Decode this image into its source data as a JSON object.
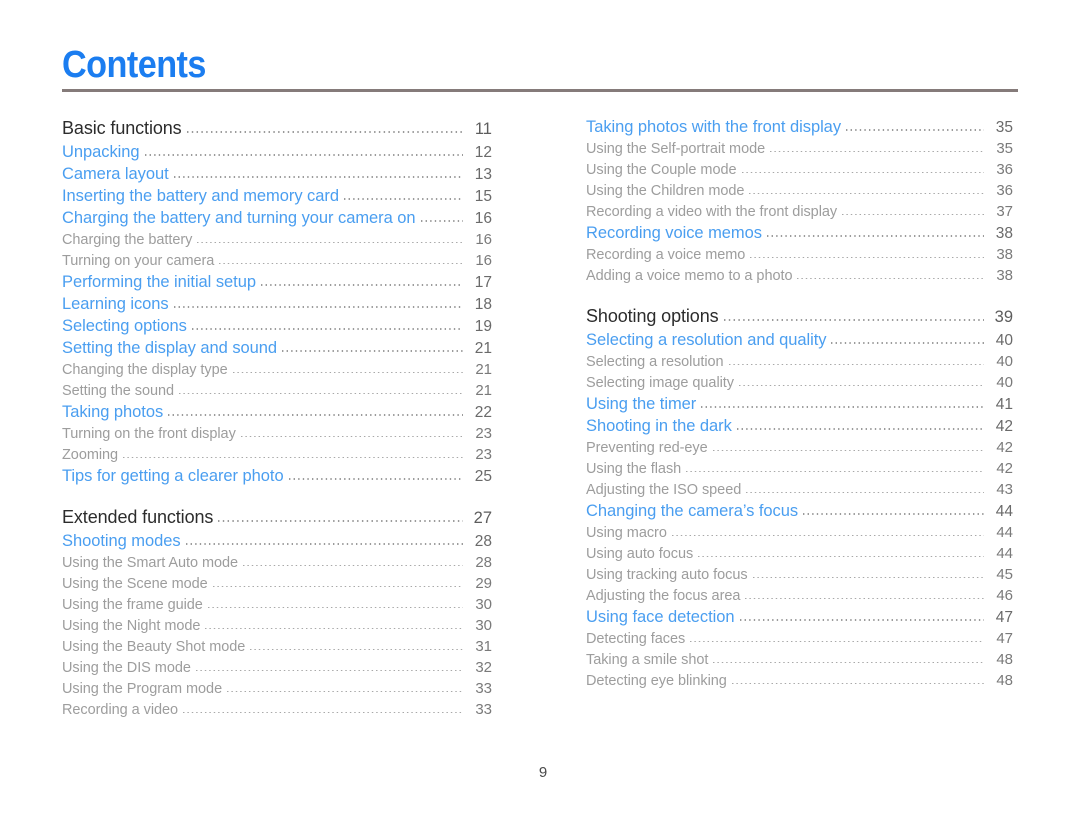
{
  "document": {
    "title": "Contents",
    "folio": "9",
    "accent_title_color": "#1b7df0",
    "link_color": "#4a9ef0",
    "subitem_color": "#9d9d9d",
    "section_color": "#2c2c2c",
    "rule_color": "#857b7a"
  },
  "columns": {
    "left": [
      {
        "level": "section",
        "label": "Basic functions",
        "page": "11"
      },
      {
        "level": "1",
        "label": "Unpacking",
        "page": "12"
      },
      {
        "level": "1",
        "label": "Camera layout",
        "page": "13"
      },
      {
        "level": "1",
        "label": "Inserting the battery and memory card",
        "page": "15"
      },
      {
        "level": "1",
        "label": "Charging the battery and turning your camera on",
        "page": "16"
      },
      {
        "level": "2",
        "label": "Charging the battery",
        "page": "16"
      },
      {
        "level": "2",
        "label": "Turning on your camera",
        "page": "16"
      },
      {
        "level": "1",
        "label": "Performing the initial setup",
        "page": "17"
      },
      {
        "level": "1",
        "label": "Learning icons",
        "page": "18"
      },
      {
        "level": "1",
        "label": "Selecting options",
        "page": "19"
      },
      {
        "level": "1",
        "label": "Setting the display and sound",
        "page": "21"
      },
      {
        "level": "2",
        "label": "Changing the display type",
        "page": "21"
      },
      {
        "level": "2",
        "label": "Setting the sound",
        "page": "21"
      },
      {
        "level": "1",
        "label": "Taking photos",
        "page": "22"
      },
      {
        "level": "2",
        "label": "Turning on the front display",
        "page": "23"
      },
      {
        "level": "2",
        "label": "Zooming",
        "page": "23"
      },
      {
        "level": "1",
        "label": "Tips for getting a clearer photo",
        "page": "25"
      },
      {
        "level": "section",
        "label": "Extended functions",
        "page": "27",
        "gap_before": true
      },
      {
        "level": "1",
        "label": "Shooting modes",
        "page": "28"
      },
      {
        "level": "2",
        "label": "Using the Smart Auto mode",
        "page": "28"
      },
      {
        "level": "2",
        "label": "Using the Scene mode",
        "page": "29"
      },
      {
        "level": "2",
        "label": "Using the frame guide",
        "page": "30"
      },
      {
        "level": "2",
        "label": "Using the Night mode",
        "page": "30"
      },
      {
        "level": "2",
        "label": "Using the Beauty Shot mode",
        "page": "31"
      },
      {
        "level": "2",
        "label": "Using the DIS mode",
        "page": "32"
      },
      {
        "level": "2",
        "label": "Using the Program mode",
        "page": "33"
      },
      {
        "level": "2",
        "label": "Recording a video",
        "page": "33"
      }
    ],
    "right": [
      {
        "level": "1",
        "label": "Taking photos with the front display",
        "page": "35"
      },
      {
        "level": "2",
        "label": "Using the Self-portrait mode",
        "page": "35"
      },
      {
        "level": "2",
        "label": "Using the Couple mode",
        "page": "36"
      },
      {
        "level": "2",
        "label": "Using the Children mode",
        "page": "36"
      },
      {
        "level": "2",
        "label": "Recording a video with the front display",
        "page": "37"
      },
      {
        "level": "1",
        "label": "Recording voice memos",
        "page": "38"
      },
      {
        "level": "2",
        "label": "Recording a voice memo",
        "page": "38"
      },
      {
        "level": "2",
        "label": "Adding a voice memo to a photo",
        "page": "38"
      },
      {
        "level": "section",
        "label": "Shooting options",
        "page": "39",
        "gap_before": true
      },
      {
        "level": "1",
        "label": "Selecting a resolution and quality",
        "page": "40"
      },
      {
        "level": "2",
        "label": "Selecting a resolution",
        "page": "40"
      },
      {
        "level": "2",
        "label": "Selecting image quality",
        "page": "40"
      },
      {
        "level": "1",
        "label": "Using the timer",
        "page": "41"
      },
      {
        "level": "1",
        "label": "Shooting in the dark",
        "page": "42"
      },
      {
        "level": "2",
        "label": "Preventing red-eye",
        "page": "42"
      },
      {
        "level": "2",
        "label": "Using the flash",
        "page": "42"
      },
      {
        "level": "2",
        "label": "Adjusting the ISO speed",
        "page": "43"
      },
      {
        "level": "1",
        "label": "Changing the camera’s focus",
        "page": "44"
      },
      {
        "level": "2",
        "label": "Using macro",
        "page": "44"
      },
      {
        "level": "2",
        "label": "Using auto focus",
        "page": "44"
      },
      {
        "level": "2",
        "label": "Using tracking auto focus",
        "page": "45"
      },
      {
        "level": "2",
        "label": "Adjusting the focus area",
        "page": "46"
      },
      {
        "level": "1",
        "label": "Using face detection",
        "page": "47"
      },
      {
        "level": "2",
        "label": "Detecting faces",
        "page": "47"
      },
      {
        "level": "2",
        "label": "Taking a smile shot",
        "page": "48"
      },
      {
        "level": "2",
        "label": "Detecting eye blinking",
        "page": "48"
      }
    ]
  }
}
